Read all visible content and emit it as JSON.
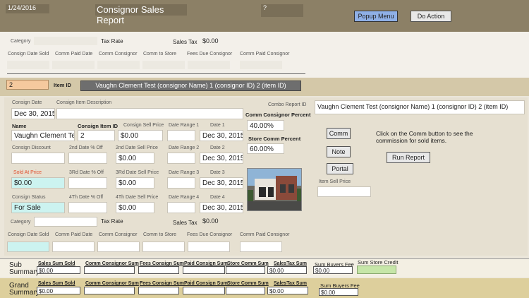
{
  "header": {
    "date": "1/24/2016",
    "title": "Consignor Sales Report",
    "help": "?",
    "popup_menu": "Popup Menu",
    "do_action": "Do Action"
  },
  "top_area": {
    "category_label": "Category",
    "tax_rate_label": "Tax Rate",
    "sales_tax_label": "Sales Tax",
    "sales_tax_value": "$0.00",
    "columns": [
      "Consign Date Sold",
      "Comm Paid Date",
      "Comm Consignor",
      "Comm to Store",
      "Fees Due Consignor",
      "Comm Paid Consignor"
    ]
  },
  "item_bar": {
    "item_value": "2",
    "item_id_label": "Item ID",
    "item_title": "Vaughn Clement Test (consignor Name) 1 (consignor ID) 2  (item ID)"
  },
  "form": {
    "consign_date_label": "Consign Date",
    "consign_date": "Dec 30, 2015",
    "consign_desc_label": "Consign Item Description",
    "name_label": "Name",
    "name": "Vaughn Clement Test",
    "consign_item_id_label": "Consign Item ID",
    "consign_item_id": "2",
    "consign_sell_price_label": "Consign Sell Price",
    "consign_sell_price": "$0.00",
    "date_range1_label": "Date Range 1",
    "date1_label": "Date 1",
    "date1": "Dec 30, 2015",
    "consign_discount_label": "Consign Discount",
    "second_date_off_label": "2nd Date % Off",
    "second_date_price_label": "2nd Date Sell Price",
    "second_date_price": "$0.00",
    "date_range2_label": "Date Range 2",
    "date2_label": "Date 2",
    "date2": "Dec 30, 2015",
    "sold_at_price_label": "Sold At Price",
    "sold_at_price": "$0.00",
    "third_date_off_label": "3Rd Date % Off",
    "third_date_price_label": "3Rd Date Sell Price",
    "third_date_price": "$0.00",
    "date_range3_label": "Date Range 3",
    "date3_label": "Date 3",
    "date3": "Dec 30, 2015",
    "consign_status_label": "Consign Status",
    "consign_status": "For Sale",
    "fourth_date_off_label": "4Th Date % Off",
    "fourth_date_price_label": "4Th Date Sell Price",
    "fourth_date_price": "$0.00",
    "date_range4_label": "Date Range 4",
    "date4_label": "Date 4",
    "date4": "Dec 30, 2015",
    "category_label": "Category",
    "tax_rate_label": "Tax Rate",
    "sales_tax_label": "Sales Tax",
    "sales_tax_value": "$0.00",
    "columns": [
      "Consign Date Sold",
      "Comm Paid Date",
      "Comm Consignor",
      "Comm to Store",
      "Fees Due Consignor",
      "Comm Paid Consignor"
    ]
  },
  "side": {
    "combo_report_label": "Combo Report ID",
    "combo_value": "Vaughn Clement Test (consignor Name) 1 (consignor ID) 2  (item ID)",
    "comm_consignor_pct_label": "Comm Consignor Percent",
    "comm_consignor_pct": "40.00%",
    "store_comm_pct_label": "Store Comm Percent",
    "store_comm_pct": "60.00%",
    "item_sell_price_label": "Item Sell Price",
    "comm_button": "Comm",
    "note_button": "Note",
    "portal_button": "Portal",
    "run_report_button": "Run Report",
    "hint": "Click on the Comm button to see the commission for sold items."
  },
  "sub_summary": {
    "title_line1": "Sub",
    "title_line2": "Summary",
    "sales_sum_sold_label": "Sales Sum Sold",
    "sales_sum_sold": "$0.00",
    "comm_consignor_sum_label": "Comm Consignor Sum",
    "fees_consign_sum_label": "Fees Consign Sum",
    "paid_consign_sum_label": "Paid Consign Sum",
    "store_comm_sum_label": "Store Comm Sum",
    "sales_tax_sum_label": "SalesTax Sum",
    "sales_tax_sum": "$0.00",
    "sum_buyers_fee_label": "Sum Buyers Fee",
    "sum_buyers_fee": "$0.00",
    "sum_store_credit_label": "Sum Store Credit"
  },
  "grand_summary": {
    "title_line1": "Grand",
    "title_line2": "Summary",
    "sales_sum_sold_label": "Sales Sum Sold",
    "sales_sum_sold": "$0.00",
    "comm_consignor_sum_label": "Comm Consignor Sum",
    "fees_consign_sum_label": "Fees Consign Sum",
    "paid_consign_sum_label": "Paid Consign Sum",
    "store_comm_sum_label": "Store Comm Sum",
    "sales_tax_sum_label": "SalesTax Sum",
    "sales_tax_sum": "$0.00",
    "sum_buyers_fee_label": "Sum Buyers Fee",
    "sum_buyers_fee": "$0.00"
  }
}
